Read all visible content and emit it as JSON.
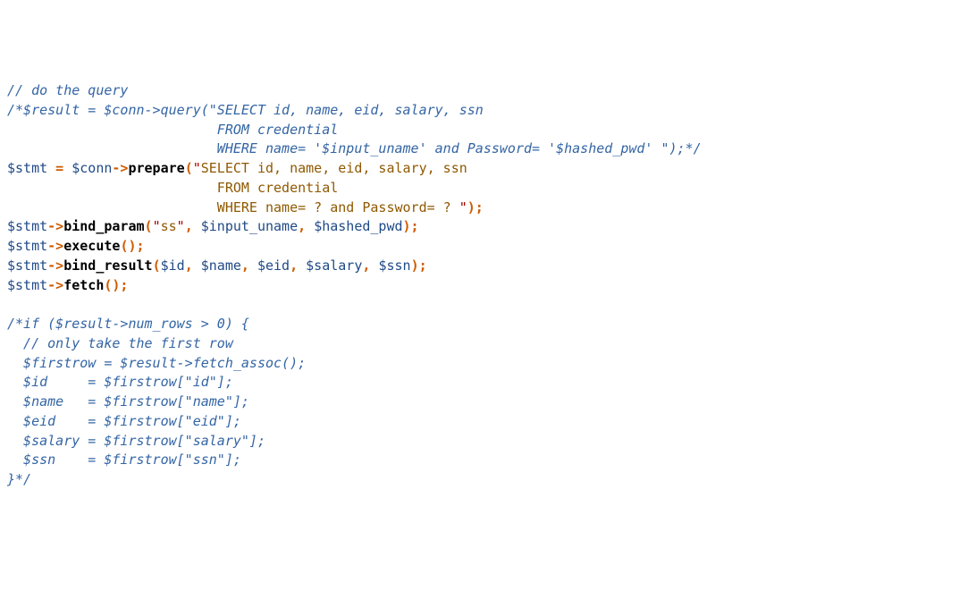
{
  "lines": {
    "l01_comment": "// do the query",
    "l02_comment": "/*$result = $conn->query(\"SELECT id, name, eid, salary, ssn",
    "l03_comment": "                          FROM credential",
    "l04_comment": "                          WHERE name= '$input_uname' and Password= '$hashed_pwd' \");*/",
    "l05_var1": "$stmt",
    "l05_eq": " = ",
    "l05_var2": "$conn",
    "l05_arrow": "->",
    "l05_fn": "prepare",
    "l05_par": "(",
    "l05_q1": "\"",
    "l05_str": "SELECT id, name, eid, salary, ssn",
    "l06_str": "                          FROM credential",
    "l07_str": "                          WHERE name= ? and Password= ? ",
    "l07_q2": "\"",
    "l07_close": ");",
    "l08_var": "$stmt",
    "l08_arrow": "->",
    "l08_fn": "bind_param",
    "l08_par": "(",
    "l08_q1": "\"",
    "l08_str": "ss",
    "l08_q2": "\"",
    "l08_c1": ", ",
    "l08_v2": "$input_uname",
    "l08_c2": ", ",
    "l08_v3": "$hashed_pwd",
    "l08_close": ");",
    "l09_var": "$stmt",
    "l09_arrow": "->",
    "l09_fn": "execute",
    "l09_close": "();",
    "l10_var": "$stmt",
    "l10_arrow": "->",
    "l10_fn": "bind_result",
    "l10_par": "(",
    "l10_v1": "$id",
    "l10_c1": ", ",
    "l10_v2": "$name",
    "l10_c2": ", ",
    "l10_v3": "$eid",
    "l10_c3": ", ",
    "l10_v4": "$salary",
    "l10_c4": ", ",
    "l10_v5": "$ssn",
    "l10_close": ");",
    "l11_var": "$stmt",
    "l11_arrow": "->",
    "l11_fn": "fetch",
    "l11_close": "();",
    "l12_blank": "",
    "l13_comment": "/*if ($result->num_rows > 0) {",
    "l14_comment": "  // only take the first row",
    "l15_comment": "  $firstrow = $result->fetch_assoc();",
    "l16_comment": "  $id     = $firstrow[\"id\"];",
    "l17_comment": "  $name   = $firstrow[\"name\"];",
    "l18_comment": "  $eid    = $firstrow[\"eid\"];",
    "l19_comment": "  $salary = $firstrow[\"salary\"];",
    "l20_comment": "  $ssn    = $firstrow[\"ssn\"];",
    "l21_comment": "}*/"
  }
}
